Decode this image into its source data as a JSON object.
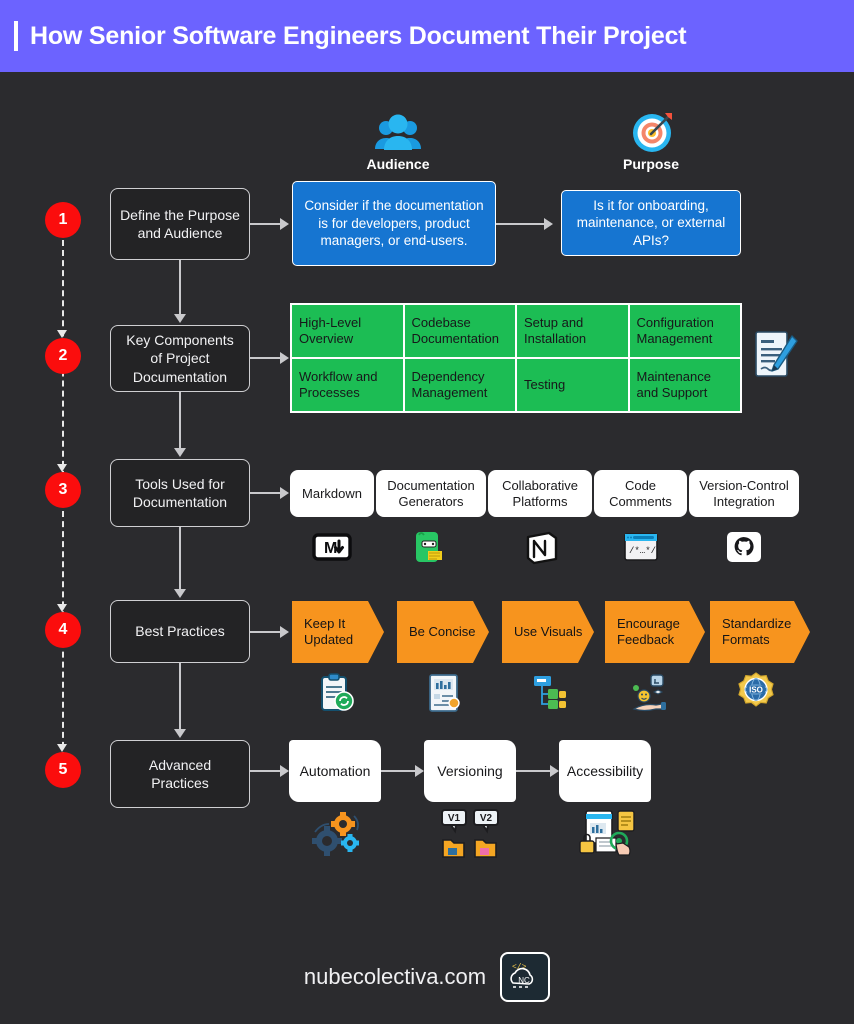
{
  "header": {
    "title": "How Senior Software Engineers Document Their Project",
    "accent_color": "#6c63ff"
  },
  "top_labels": {
    "audience": "Audience",
    "purpose": "Purpose"
  },
  "steps": [
    {
      "number": "1",
      "label": "Define the Purpose and Audience"
    },
    {
      "number": "2",
      "label": "Key Components of Project Documentation"
    },
    {
      "number": "3",
      "label": "Tools Used for Documentation"
    },
    {
      "number": "4",
      "label": "Best Practices"
    },
    {
      "number": "5",
      "label": "Advanced Practices"
    }
  ],
  "step1_boxes": [
    {
      "text": "Consider if the documentation is for developers, product managers, or end-users."
    },
    {
      "text": "Is it for onboarding, maintenance, or external APIs?"
    }
  ],
  "key_components": [
    "High-Level Overview",
    "Codebase Documentation",
    "Setup and Installation",
    "Configuration Management",
    "Workflow and Processes",
    "Dependency Management",
    "Testing",
    "Maintenance and Support"
  ],
  "tools": [
    {
      "label": "Markdown",
      "icon": "markdown-icon"
    },
    {
      "label": "Documentation Generators",
      "icon": "doc-generator-icon"
    },
    {
      "label": "Collaborative Platforms",
      "icon": "notion-icon"
    },
    {
      "label": "Code Comments",
      "icon": "code-comment-icon"
    },
    {
      "label": "Version-Control Integration",
      "icon": "github-icon"
    }
  ],
  "best_practices": [
    {
      "label": "Keep It Updated",
      "icon": "clipboard-refresh-icon"
    },
    {
      "label": "Be Concise",
      "icon": "report-chart-icon"
    },
    {
      "label": "Use Visuals",
      "icon": "sitemap-icon"
    },
    {
      "label": "Encourage Feedback",
      "icon": "feedback-hand-icon"
    },
    {
      "label": "Standardize Formats",
      "icon": "iso-badge-icon"
    }
  ],
  "advanced_practices": [
    {
      "label": "Automation",
      "icon": "gears-icon"
    },
    {
      "label": "Versioning",
      "icon": "version-folders-icon",
      "tags": [
        "V1",
        "V2"
      ]
    },
    {
      "label": "Accessibility",
      "icon": "accessibility-doc-icon"
    }
  ],
  "footer": {
    "site": "nubecolectiva.com",
    "logo_text": "NC",
    "logo_code": "</>"
  },
  "colors": {
    "background": "#2b2b2e",
    "header": "#6c63ff",
    "step_circle": "#fb0d0d",
    "blue_box": "#1675d1",
    "green_cell": "#1cbd54",
    "orange_chevron": "#f7941e"
  }
}
